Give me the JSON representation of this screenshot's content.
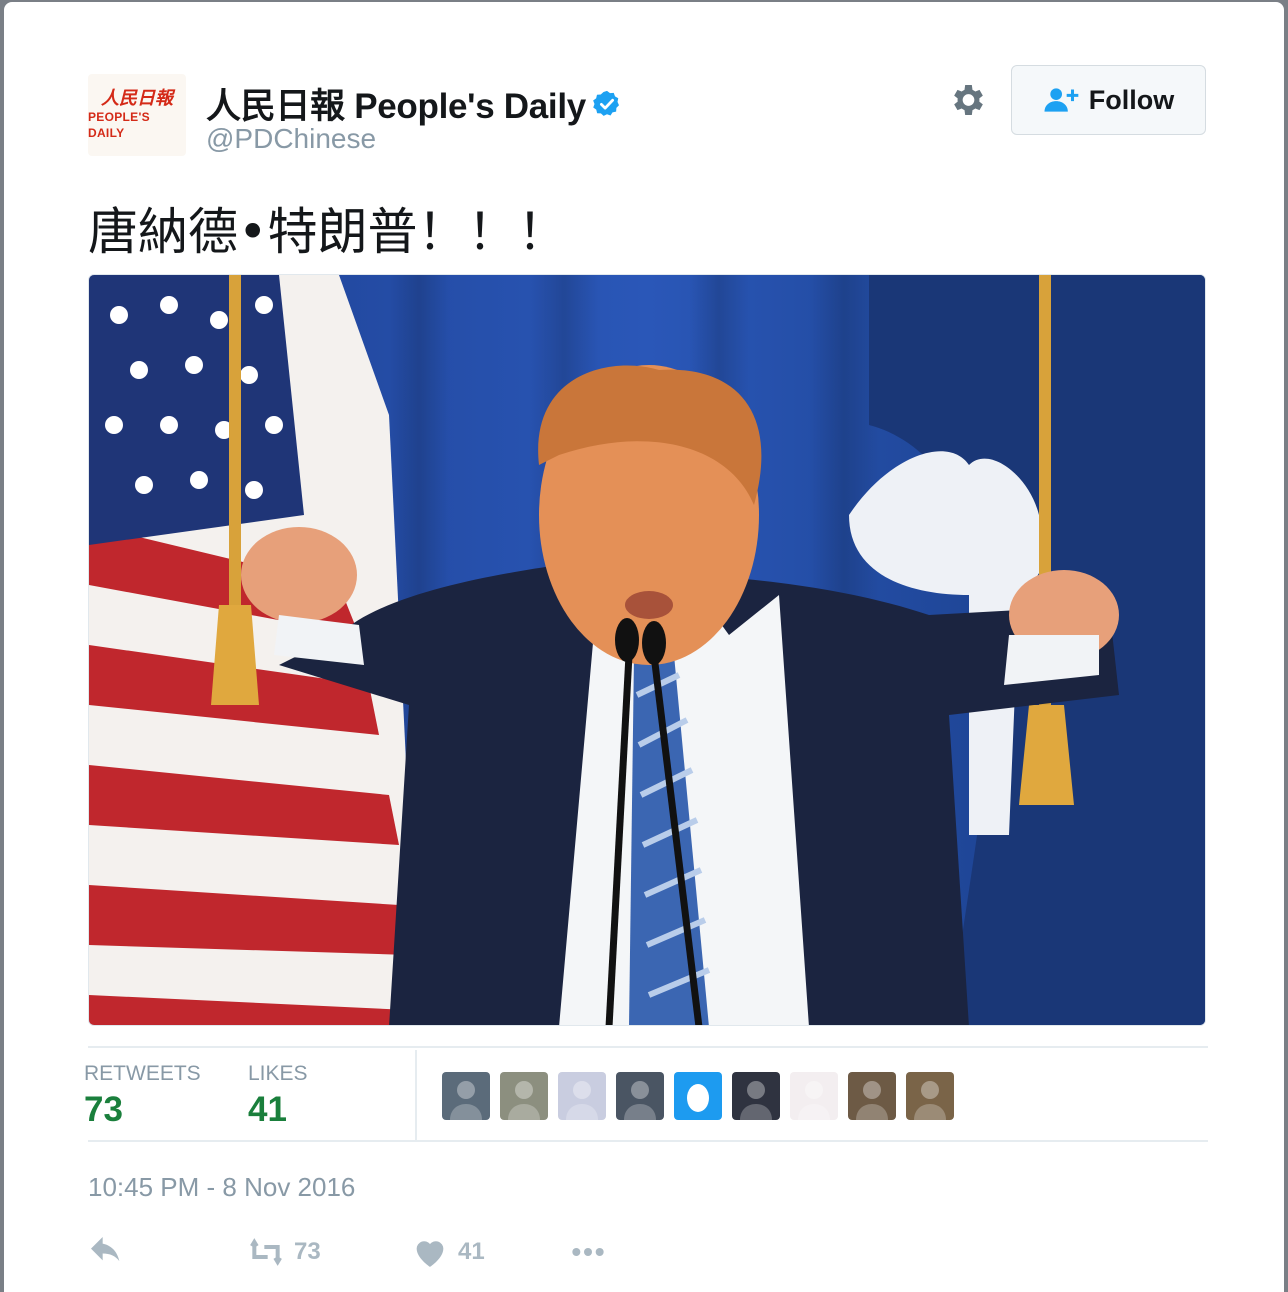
{
  "account": {
    "name": "人民日報 People's Daily",
    "handle": "@PDChinese",
    "avatar_text_cn": "人民日報",
    "avatar_text_en": "PEOPLE'S DAILY",
    "verified_icon": "verified-badge-icon"
  },
  "header": {
    "follow_label": "Follow",
    "follow_icon": "add-user-icon",
    "settings_icon": "gear-icon"
  },
  "tweet": {
    "text": "唐納德•特朗普！！！"
  },
  "stats": {
    "retweets_label": "RETWEETS",
    "retweets_value": "73",
    "likes_label": "LIKES",
    "likes_value": "41"
  },
  "likers": [
    {
      "name": "liker-avatar-1",
      "color": "#5b6b7a"
    },
    {
      "name": "liker-avatar-2",
      "color": "#8c8f7f"
    },
    {
      "name": "liker-avatar-3",
      "color": "#c9cde0"
    },
    {
      "name": "liker-avatar-4",
      "color": "#4a5563"
    },
    {
      "name": "liker-avatar-egg",
      "color": "#1d9bf0"
    },
    {
      "name": "liker-avatar-6",
      "color": "#2f3340"
    },
    {
      "name": "liker-avatar-7",
      "color": "#f3eef0"
    },
    {
      "name": "liker-avatar-8",
      "color": "#6d5a45"
    },
    {
      "name": "liker-avatar-9",
      "color": "#7a6448"
    }
  ],
  "timestamp": "10:45 PM - 8 Nov 2016",
  "actions": {
    "reply_icon": "reply-icon",
    "retweet_icon": "retweet-icon",
    "retweet_count": "73",
    "like_icon": "heart-icon",
    "like_count": "41",
    "more_icon": "more-icon"
  },
  "colors": {
    "accent_blue": "#1da1f2",
    "count_green": "#1a7f3c",
    "muted_text": "#8899a6"
  }
}
